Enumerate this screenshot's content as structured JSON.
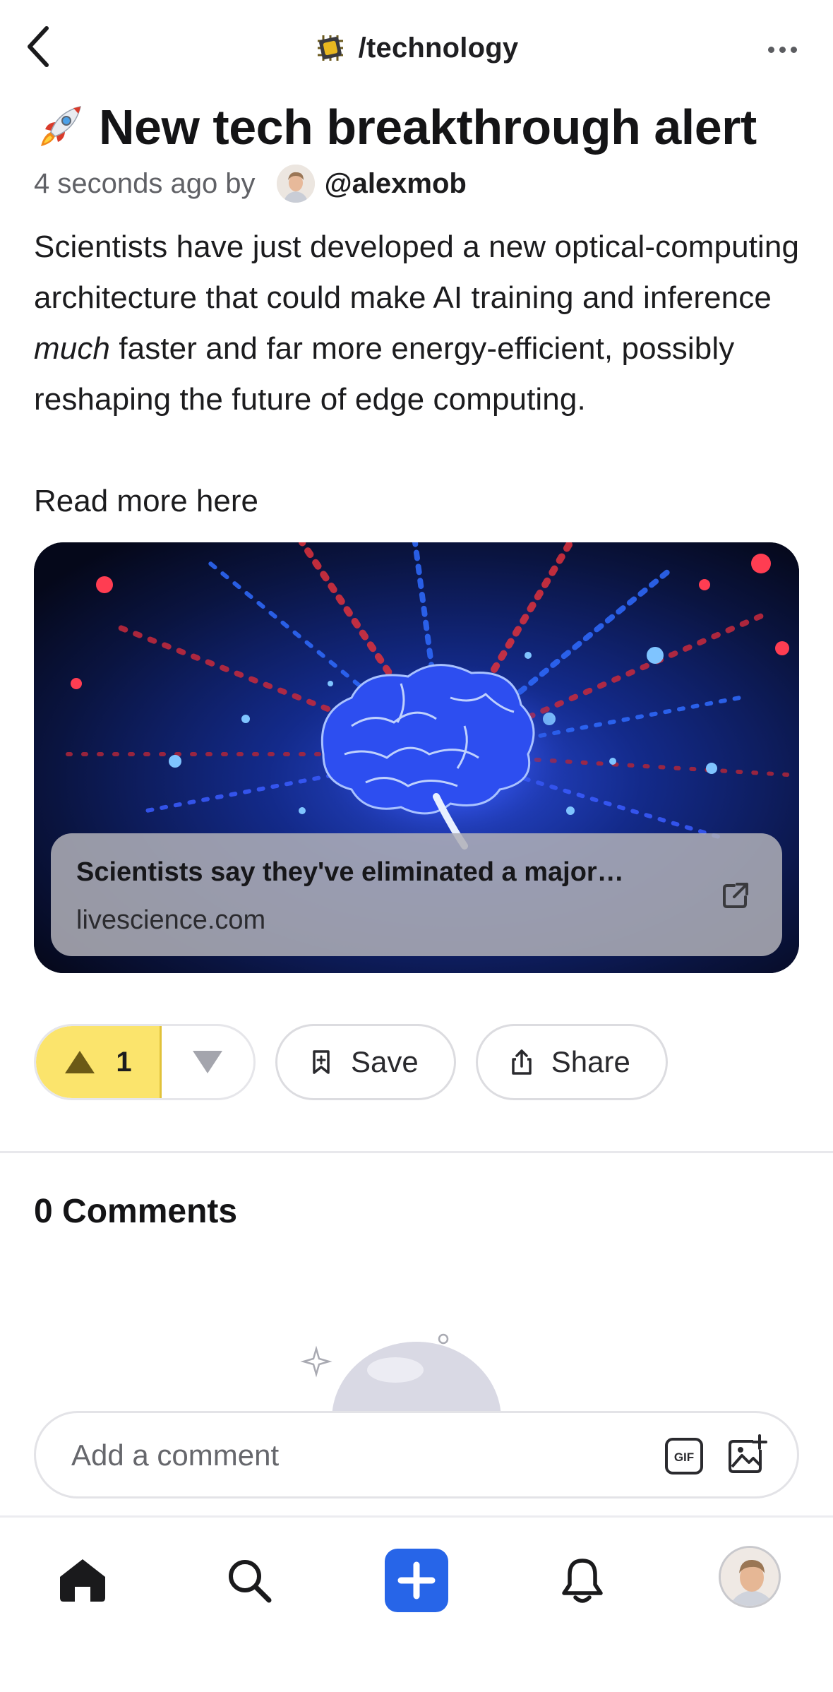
{
  "header": {
    "community_name": "/technology",
    "community_icon": "microchip-icon",
    "back_icon": "chevron-left-icon",
    "more_icon": "more-dots-icon"
  },
  "post": {
    "title_emoji": "rocket-icon",
    "title": "New tech breakthrough alert",
    "time_ago": "4 seconds ago by",
    "author": "@alexmob",
    "body_part1": "Scientists have just developed a new optical-computing architecture that could make AI training and inference ",
    "body_emphasis": "much",
    "body_part2": " faster and far more energy-efficient, possibly reshaping the future of edge computing.",
    "read_more": "Read more here",
    "link": {
      "title": "Scientists say they've eliminated a major…",
      "domain": "livescience.com",
      "image": "glowing-brain-illustration"
    }
  },
  "actions": {
    "upvote_count": "1",
    "upvote_active": true,
    "save_label": "Save",
    "share_label": "Share"
  },
  "comments": {
    "title": "0 Comments",
    "input_placeholder": "Add a comment",
    "gif_label": "GIF"
  },
  "nav": {
    "items": [
      "home-icon",
      "search-icon",
      "create-icon",
      "bell-icon",
      "profile-avatar"
    ]
  },
  "colors": {
    "upvote_bg": "#fbe46c",
    "create_bg": "#2765e8",
    "text_primary": "#1c1c1e",
    "text_secondary": "#606166"
  }
}
